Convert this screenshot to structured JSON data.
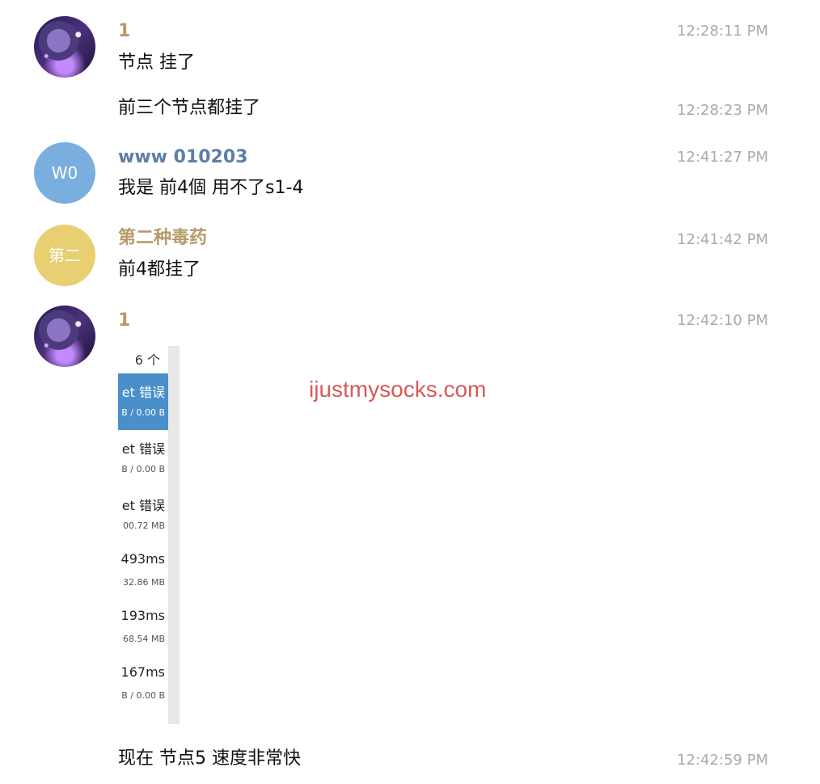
{
  "messages": [
    {
      "author": "1",
      "text": "节点 挂了",
      "time": "12:28:11 PM"
    },
    {
      "text": "前三个节点都挂了",
      "time": "12:28:23 PM"
    },
    {
      "author": "www 010203",
      "avatar_text": "W0",
      "text": "我是 前4個 用不了s1-4",
      "time": "12:41:27 PM"
    },
    {
      "author": "第二种毒药",
      "avatar_text": "第二",
      "text": "前4都挂了",
      "time": "12:41:42 PM"
    },
    {
      "author": "1",
      "time": "12:42:10 PM",
      "attachment": {
        "count": "6 个",
        "rows": [
          {
            "title": "et 错误",
            "subtitle": "B / 0.00 B",
            "selected": true
          },
          {
            "title": "et 错误",
            "subtitle": "B / 0.00 B",
            "selected": false
          },
          {
            "title": "et 错误",
            "subtitle": "00.72 MB",
            "selected": false
          },
          {
            "title": "493ms",
            "subtitle": "32.86 MB",
            "selected": false
          },
          {
            "title": "193ms",
            "subtitle": "68.54 MB",
            "selected": false
          },
          {
            "title": "167ms",
            "subtitle": "B / 0.00 B",
            "selected": false
          }
        ]
      }
    },
    {
      "text": "现在 节点5  速度非常快",
      "time": "12:42:59 PM"
    }
  ],
  "watermark": "ijustmysocks.com",
  "colors": {
    "gold_name": "#b59b69",
    "blue_name": "#5d7fa7",
    "blue_avatar": "#7aaedf",
    "yellow_avatar": "#e7cf72",
    "time": "#a9a9a9",
    "watermark": "#d45b5b",
    "selected_row": "#4a8fc9"
  },
  "icons": {
    "space_avatar": "space-planet-avatar-icon"
  }
}
